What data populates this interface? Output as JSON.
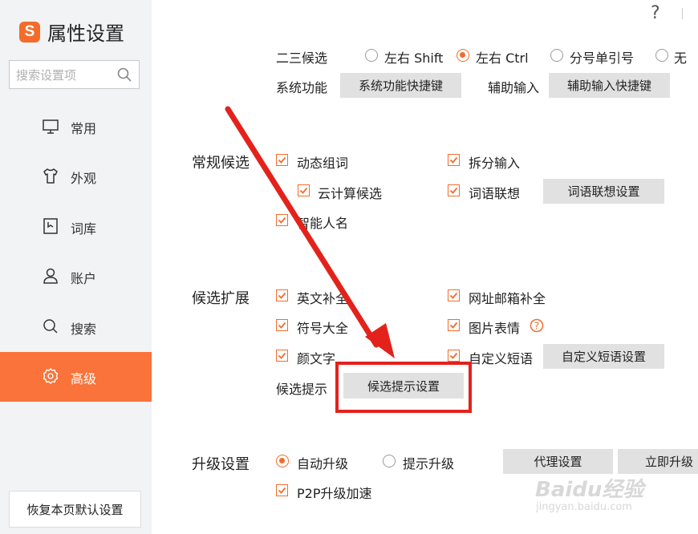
{
  "sidebar": {
    "logo_letter": "S",
    "title": "属性设置",
    "search_placeholder": "搜索设置项",
    "nav": [
      {
        "label": "常用",
        "icon": "monitor-icon"
      },
      {
        "label": "外观",
        "icon": "shirt-icon"
      },
      {
        "label": "词库",
        "icon": "dictionary-icon"
      },
      {
        "label": "账户",
        "icon": "user-icon"
      },
      {
        "label": "搜索",
        "icon": "search-icon"
      },
      {
        "label": "高级",
        "icon": "gear-icon",
        "active": true
      }
    ],
    "reset_label": "恢复本页默认设置"
  },
  "top": {
    "help": "?"
  },
  "row_23": {
    "label": "二三候选",
    "options": [
      {
        "label": "左右 Shift",
        "selected": false
      },
      {
        "label": "左右 Ctrl",
        "selected": true
      },
      {
        "label": "分号单引号",
        "selected": false
      },
      {
        "label": "无",
        "selected": false
      }
    ]
  },
  "row_sys": {
    "label": "系统功能",
    "button": "系统功能快捷键",
    "label2": "辅助输入",
    "button2": "辅助输入快捷键"
  },
  "normal_candidates": {
    "title": "常规候选",
    "items": [
      {
        "label": "动态组词",
        "checked": true
      },
      {
        "label": "拆分输入",
        "checked": true
      },
      {
        "label": "云计算候选",
        "checked": true
      },
      {
        "label": "词语联想",
        "checked": true
      },
      {
        "label": "智能人名",
        "checked": true
      }
    ],
    "button": "词语联想设置"
  },
  "candidate_ext": {
    "title": "候选扩展",
    "items": [
      {
        "label": "英文补全",
        "checked": true
      },
      {
        "label": "网址邮箱补全",
        "checked": true
      },
      {
        "label": "符号大全",
        "checked": true
      },
      {
        "label": "图片表情",
        "checked": true
      },
      {
        "label": "颜文字",
        "checked": true
      },
      {
        "label": "自定义短语",
        "checked": true
      }
    ],
    "help_mark": "?",
    "custom_button": "自定义短语设置",
    "hint_label": "候选提示",
    "hint_button": "候选提示设置"
  },
  "upgrade": {
    "title": "升级设置",
    "options": [
      {
        "label": "自动升级",
        "selected": true
      },
      {
        "label": "提示升级",
        "selected": false
      }
    ],
    "proxy_button": "代理设置",
    "now_button": "立即升级",
    "p2p": {
      "label": "P2P升级加速",
      "checked": true
    }
  },
  "watermark": {
    "brand": "Baidu经验",
    "url": "jingyan.baidu.com"
  },
  "colors": {
    "accent": "#f36c2c",
    "active_bg": "#f9733a",
    "annotation_red": "#e3221c"
  }
}
